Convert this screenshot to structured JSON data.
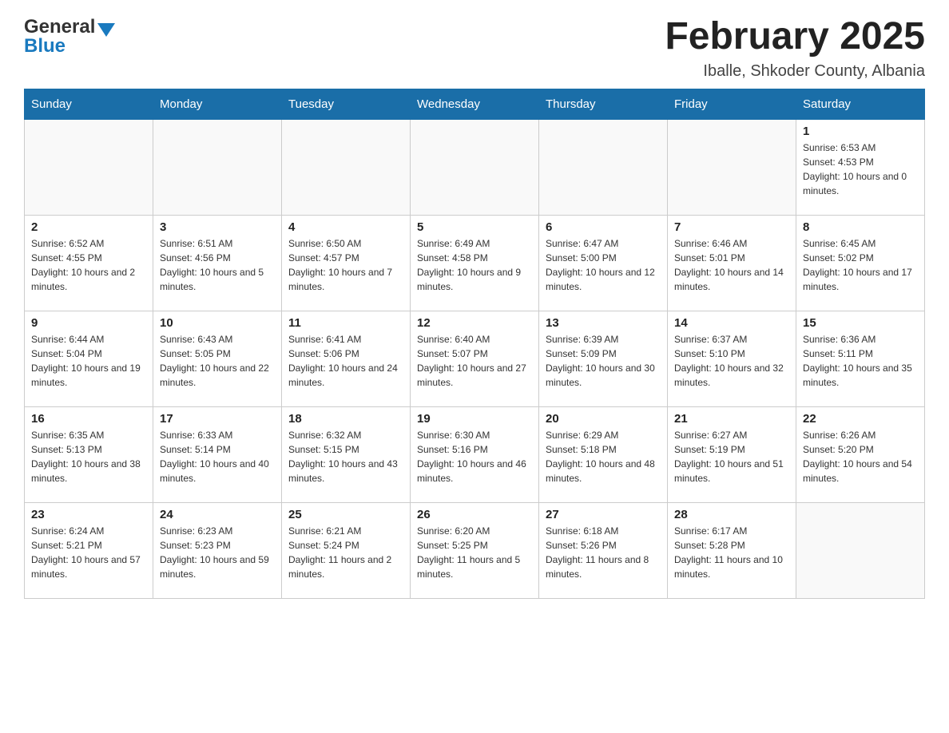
{
  "header": {
    "logo_general": "General",
    "logo_blue": "Blue",
    "month_title": "February 2025",
    "location": "Iballe, Shkoder County, Albania"
  },
  "days_of_week": [
    "Sunday",
    "Monday",
    "Tuesday",
    "Wednesday",
    "Thursday",
    "Friday",
    "Saturday"
  ],
  "weeks": [
    [
      {
        "day": "",
        "info": ""
      },
      {
        "day": "",
        "info": ""
      },
      {
        "day": "",
        "info": ""
      },
      {
        "day": "",
        "info": ""
      },
      {
        "day": "",
        "info": ""
      },
      {
        "day": "",
        "info": ""
      },
      {
        "day": "1",
        "info": "Sunrise: 6:53 AM\nSunset: 4:53 PM\nDaylight: 10 hours and 0 minutes."
      }
    ],
    [
      {
        "day": "2",
        "info": "Sunrise: 6:52 AM\nSunset: 4:55 PM\nDaylight: 10 hours and 2 minutes."
      },
      {
        "day": "3",
        "info": "Sunrise: 6:51 AM\nSunset: 4:56 PM\nDaylight: 10 hours and 5 minutes."
      },
      {
        "day": "4",
        "info": "Sunrise: 6:50 AM\nSunset: 4:57 PM\nDaylight: 10 hours and 7 minutes."
      },
      {
        "day": "5",
        "info": "Sunrise: 6:49 AM\nSunset: 4:58 PM\nDaylight: 10 hours and 9 minutes."
      },
      {
        "day": "6",
        "info": "Sunrise: 6:47 AM\nSunset: 5:00 PM\nDaylight: 10 hours and 12 minutes."
      },
      {
        "day": "7",
        "info": "Sunrise: 6:46 AM\nSunset: 5:01 PM\nDaylight: 10 hours and 14 minutes."
      },
      {
        "day": "8",
        "info": "Sunrise: 6:45 AM\nSunset: 5:02 PM\nDaylight: 10 hours and 17 minutes."
      }
    ],
    [
      {
        "day": "9",
        "info": "Sunrise: 6:44 AM\nSunset: 5:04 PM\nDaylight: 10 hours and 19 minutes."
      },
      {
        "day": "10",
        "info": "Sunrise: 6:43 AM\nSunset: 5:05 PM\nDaylight: 10 hours and 22 minutes."
      },
      {
        "day": "11",
        "info": "Sunrise: 6:41 AM\nSunset: 5:06 PM\nDaylight: 10 hours and 24 minutes."
      },
      {
        "day": "12",
        "info": "Sunrise: 6:40 AM\nSunset: 5:07 PM\nDaylight: 10 hours and 27 minutes."
      },
      {
        "day": "13",
        "info": "Sunrise: 6:39 AM\nSunset: 5:09 PM\nDaylight: 10 hours and 30 minutes."
      },
      {
        "day": "14",
        "info": "Sunrise: 6:37 AM\nSunset: 5:10 PM\nDaylight: 10 hours and 32 minutes."
      },
      {
        "day": "15",
        "info": "Sunrise: 6:36 AM\nSunset: 5:11 PM\nDaylight: 10 hours and 35 minutes."
      }
    ],
    [
      {
        "day": "16",
        "info": "Sunrise: 6:35 AM\nSunset: 5:13 PM\nDaylight: 10 hours and 38 minutes."
      },
      {
        "day": "17",
        "info": "Sunrise: 6:33 AM\nSunset: 5:14 PM\nDaylight: 10 hours and 40 minutes."
      },
      {
        "day": "18",
        "info": "Sunrise: 6:32 AM\nSunset: 5:15 PM\nDaylight: 10 hours and 43 minutes."
      },
      {
        "day": "19",
        "info": "Sunrise: 6:30 AM\nSunset: 5:16 PM\nDaylight: 10 hours and 46 minutes."
      },
      {
        "day": "20",
        "info": "Sunrise: 6:29 AM\nSunset: 5:18 PM\nDaylight: 10 hours and 48 minutes."
      },
      {
        "day": "21",
        "info": "Sunrise: 6:27 AM\nSunset: 5:19 PM\nDaylight: 10 hours and 51 minutes."
      },
      {
        "day": "22",
        "info": "Sunrise: 6:26 AM\nSunset: 5:20 PM\nDaylight: 10 hours and 54 minutes."
      }
    ],
    [
      {
        "day": "23",
        "info": "Sunrise: 6:24 AM\nSunset: 5:21 PM\nDaylight: 10 hours and 57 minutes."
      },
      {
        "day": "24",
        "info": "Sunrise: 6:23 AM\nSunset: 5:23 PM\nDaylight: 10 hours and 59 minutes."
      },
      {
        "day": "25",
        "info": "Sunrise: 6:21 AM\nSunset: 5:24 PM\nDaylight: 11 hours and 2 minutes."
      },
      {
        "day": "26",
        "info": "Sunrise: 6:20 AM\nSunset: 5:25 PM\nDaylight: 11 hours and 5 minutes."
      },
      {
        "day": "27",
        "info": "Sunrise: 6:18 AM\nSunset: 5:26 PM\nDaylight: 11 hours and 8 minutes."
      },
      {
        "day": "28",
        "info": "Sunrise: 6:17 AM\nSunset: 5:28 PM\nDaylight: 11 hours and 10 minutes."
      },
      {
        "day": "",
        "info": ""
      }
    ]
  ]
}
